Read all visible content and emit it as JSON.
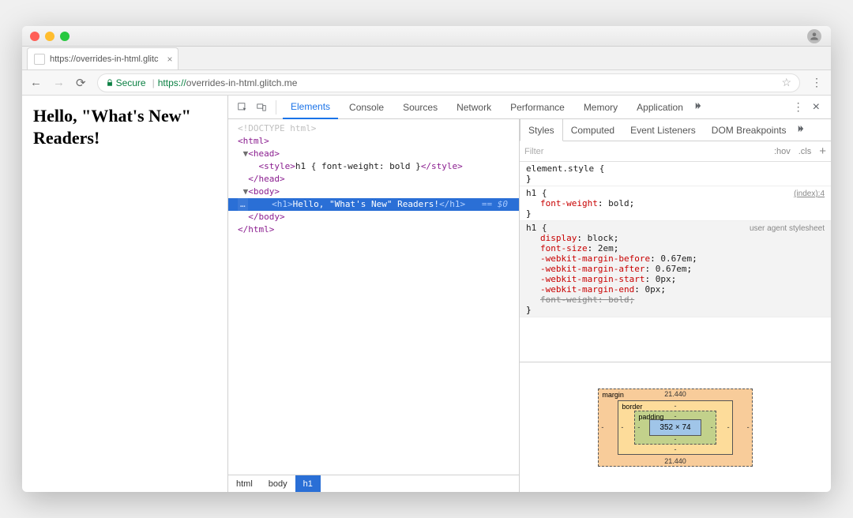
{
  "browser": {
    "tab_title": "https://overrides-in-html.glitc",
    "secure_label": "Secure",
    "url_host": "https://",
    "url_rest": "overrides-in-html.glitch.me"
  },
  "page": {
    "heading": "Hello, \"What's New\" Readers!"
  },
  "devtools": {
    "tabs": [
      "Elements",
      "Console",
      "Sources",
      "Network",
      "Performance",
      "Memory",
      "Application"
    ],
    "active_tab": "Elements",
    "dom": {
      "doctype": "<!DOCTYPE html>",
      "html_open": "<html>",
      "head_open": "<head>",
      "style_line_open": "<style>",
      "style_line_text": "h1 { font-weight: bold }",
      "style_line_close": "</style>",
      "head_close": "</head>",
      "body_open": "<body>",
      "h1_open": "<h1>",
      "h1_text": "Hello, \"What's New\" Readers!",
      "h1_close": "</h1>",
      "selected_suffix": " == $0",
      "body_close": "</body>",
      "html_close": "</html>",
      "ellipsis": "…"
    },
    "breadcrumbs": [
      "html",
      "body",
      "h1"
    ]
  },
  "styles": {
    "tabs": [
      "Styles",
      "Computed",
      "Event Listeners",
      "DOM Breakpoints"
    ],
    "active_tab": "Styles",
    "filter_placeholder": "Filter",
    "hov": ":hov",
    "cls": ".cls",
    "rules": [
      {
        "selector": "element.style {",
        "close": "}",
        "props": []
      },
      {
        "selector": "h1 {",
        "location": "(index):4",
        "props": [
          {
            "k": "font-weight",
            "v": "bold"
          }
        ],
        "close": "}"
      },
      {
        "selector": "h1 {",
        "ua_label": "user agent stylesheet",
        "ua": true,
        "props": [
          {
            "k": "display",
            "v": "block"
          },
          {
            "k": "font-size",
            "v": "2em"
          },
          {
            "k": "-webkit-margin-before",
            "v": "0.67em"
          },
          {
            "k": "-webkit-margin-after",
            "v": "0.67em"
          },
          {
            "k": "-webkit-margin-start",
            "v": "0px"
          },
          {
            "k": "-webkit-margin-end",
            "v": "0px"
          },
          {
            "k": "font-weight",
            "v": "bold",
            "strike": true
          }
        ],
        "close": "}"
      }
    ],
    "box_model": {
      "margin_label": "margin",
      "border_label": "border",
      "padding_label": "padding",
      "margin_top": "21.440",
      "margin_bottom": "21.440",
      "margin_left": "-",
      "margin_right": "-",
      "border_all": "-",
      "padding_all": "-",
      "content": "352 × 74"
    }
  }
}
